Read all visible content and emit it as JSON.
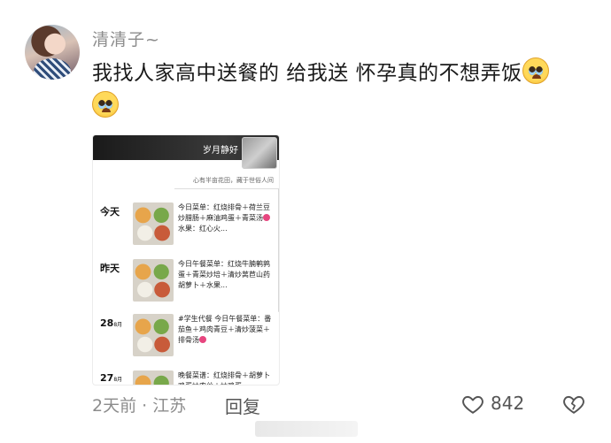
{
  "user": {
    "name": "清清子~"
  },
  "comment": {
    "text": "我找人家高中送餐的 给我送 怀孕真的不想弄饭"
  },
  "screenshot": {
    "title": "岁月静好",
    "motto": "心有半亩花田，藏于世俗人间",
    "entries": [
      {
        "day": "今天",
        "sub": "",
        "menu_parts": [
          "今日菜单：红烧排骨＋荷兰豆炒腊肠＋麻油鸡蛋＋青菜汤",
          "水果：红心火..."
        ]
      },
      {
        "day": "昨天",
        "sub": "",
        "menu_parts": [
          "今日午餐菜单：红烧牛腩鹌鹑蛋＋青菜炒培＋清炒莴苣山药胡萝卜＋水果..."
        ]
      },
      {
        "day": "28",
        "sub": "8月",
        "menu_parts": [
          "#学生代餐 今日午餐菜单：番茄鱼＋鸡肉青豆＋清炒菠菜＋排骨汤",
          ""
        ]
      },
      {
        "day": "27",
        "sub": "8月",
        "menu_parts": [
          "晚餐菜谱：红烧排骨＋胡萝卜鸡蛋炒肉丝＋炒鸡蛋..."
        ]
      }
    ]
  },
  "footer": {
    "meta": "2天前 · 江苏",
    "reply": "回复",
    "like_count": "842"
  },
  "icons": {
    "like": "heart-outline-icon",
    "dislike": "broken-heart-icon",
    "emoji": "pleading-face-emoji"
  }
}
